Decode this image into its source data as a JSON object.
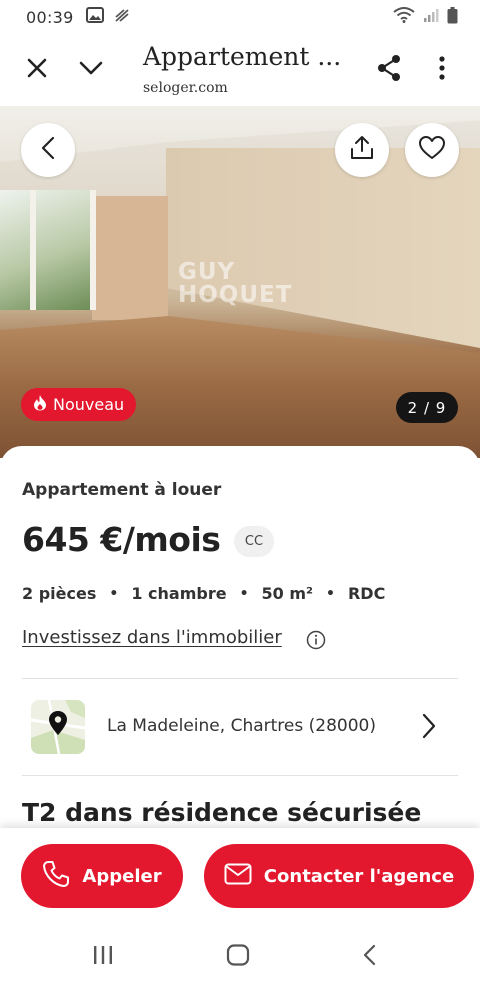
{
  "status_bar": {
    "time": "00:39",
    "icons": [
      "image-icon",
      "notification-icon",
      "wifi-icon",
      "signal-icon",
      "battery-icon"
    ]
  },
  "toolbar": {
    "title": "Appartement ...",
    "url": "seloger.com",
    "icons": [
      "close-icon",
      "chevron-down-icon",
      "share-icon",
      "more-vertical-icon"
    ]
  },
  "photo": {
    "watermark_line1": "GUY",
    "watermark_line2": "HOQUET",
    "badge_new": "Nouveau",
    "counter": "2 / 9",
    "icons": [
      "back-icon",
      "export-icon",
      "heart-icon",
      "fire-icon"
    ]
  },
  "listing": {
    "type": "Appartement à louer",
    "price": "645 €/mois",
    "price_badge": "CC",
    "features": [
      "2 pièces",
      "1 chambre",
      "50 m²",
      "RDC"
    ],
    "invest_link": "Investissez dans l'immobilier",
    "location": "La Madeleine, Chartres (28000)",
    "description_title": "T2 dans résidence sécurisée"
  },
  "actions": {
    "call_label": "Appeler",
    "contact_label": "Contacter l'agence"
  },
  "colors": {
    "accent": "#e3172d",
    "counter_bg": "#151515"
  }
}
